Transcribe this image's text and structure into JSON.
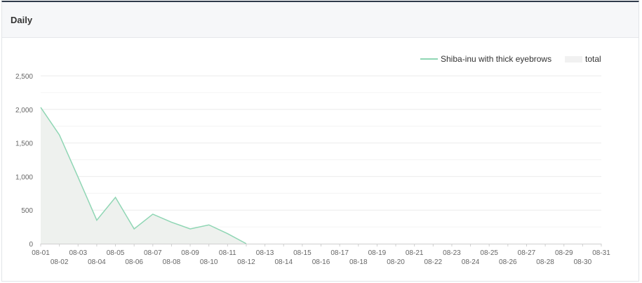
{
  "panel": {
    "title": "Daily"
  },
  "chart_data": {
    "type": "area",
    "title": "",
    "xlabel": "",
    "ylabel": "",
    "ylim": [
      0,
      2500
    ],
    "y_ticks": [
      "0",
      "500",
      "1,000",
      "1,500",
      "2,000",
      "2,500"
    ],
    "grid": true,
    "legend_position": "top-right",
    "colors": {
      "line": "#8fd6b4",
      "area": "#eef1ee"
    },
    "categories": [
      "08-01",
      "08-02",
      "08-03",
      "08-04",
      "08-05",
      "08-06",
      "08-07",
      "08-08",
      "08-09",
      "08-10",
      "08-11",
      "08-12",
      "08-13",
      "08-14",
      "08-15",
      "08-16",
      "08-17",
      "08-18",
      "08-19",
      "08-20",
      "08-21",
      "08-22",
      "08-23",
      "08-24",
      "08-25",
      "08-26",
      "08-27",
      "08-28",
      "08-29",
      "08-30",
      "08-31"
    ],
    "series": [
      {
        "name": "Shiba-inu with thick eyebrows",
        "style": "line",
        "values": [
          2030,
          1620,
          990,
          350,
          690,
          220,
          440,
          320,
          220,
          280,
          150,
          0,
          0,
          0,
          0,
          0,
          0,
          0,
          0,
          0,
          0,
          0,
          0,
          0,
          0,
          0,
          0,
          0,
          0,
          0,
          0
        ]
      },
      {
        "name": "total",
        "style": "area",
        "values": [
          2030,
          1620,
          990,
          350,
          690,
          220,
          440,
          320,
          220,
          280,
          150,
          0,
          0,
          0,
          0,
          0,
          0,
          0,
          0,
          0,
          0,
          0,
          0,
          0,
          0,
          0,
          0,
          0,
          0,
          0,
          0
        ]
      }
    ]
  }
}
